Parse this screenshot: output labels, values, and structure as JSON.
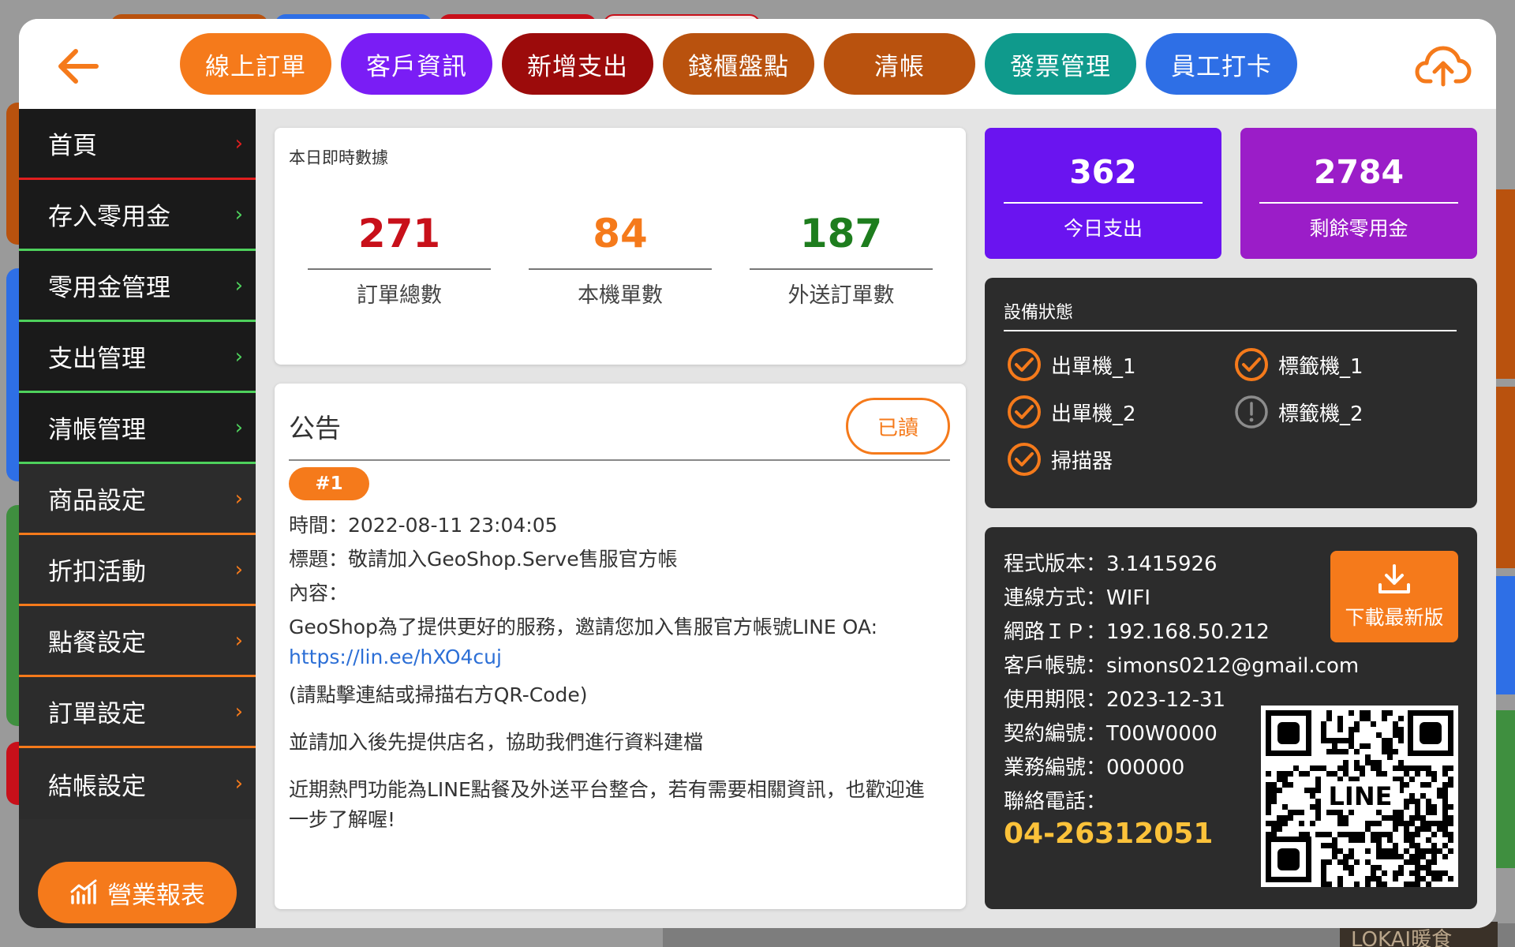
{
  "top_tabs": [
    {
      "label": "線上訂單",
      "color": "#f57a1b"
    },
    {
      "label": "客戶資訊",
      "color": "#7a1df5"
    },
    {
      "label": "新增支出",
      "color": "#9c0b0b"
    },
    {
      "label": "錢櫃盤點",
      "color": "#b9520e"
    },
    {
      "label": "清帳",
      "color": "#b9520e"
    },
    {
      "label": "發票管理",
      "color": "#0f9a8c"
    },
    {
      "label": "員工打卡",
      "color": "#2e6fe6"
    }
  ],
  "sidebar": {
    "items": [
      {
        "label": "首頁"
      },
      {
        "label": "存入零用金"
      },
      {
        "label": "零用金管理"
      },
      {
        "label": "支出管理"
      },
      {
        "label": "清帳管理"
      },
      {
        "label": "商品設定"
      },
      {
        "label": "折扣活動"
      },
      {
        "label": "點餐設定"
      },
      {
        "label": "訂單設定"
      },
      {
        "label": "結帳設定"
      }
    ],
    "chevron": "›",
    "report_button": "營業報表"
  },
  "stats": {
    "title": "本日即時數據",
    "items": [
      {
        "value": "271",
        "label": "訂單總數",
        "color": "#c8101a"
      },
      {
        "value": "84",
        "label": "本機單數",
        "color": "#f57a1b"
      },
      {
        "value": "187",
        "label": "外送訂單數",
        "color": "#1e7d1e"
      }
    ]
  },
  "kpis": [
    {
      "value": "362",
      "label": "今日支出",
      "color": "#6a14f0"
    },
    {
      "value": "2784",
      "label": "剩餘零用金",
      "color": "#9b1dc8"
    }
  ],
  "announcement": {
    "title": "公告",
    "read_button": "已讀",
    "badge": "#1",
    "time": "時間：2022-08-11 23:04:05",
    "subject": "標題：敬請加入GeoShop.Serve售服官方帳",
    "content_label": "內容：",
    "line1": "GeoShop為了提供更好的服務，邀請您加入售服官方帳號LINE OA:",
    "link": "https://lin.ee/hXO4cuj",
    "line2": "(請點擊連結或掃描右方QR-Code)",
    "line3": "並請加入後先提供店名，協助我們進行資料建檔",
    "line4a": "近期熱門功能為LINE點餐及外送平台整合，若有需要相關資訊，也歡迎進",
    "line4b": "一步了解喔!"
  },
  "devices": {
    "title": "設備狀態",
    "items": [
      {
        "name": "出單機_1",
        "status": "ok"
      },
      {
        "name": "標籤機_1",
        "status": "ok"
      },
      {
        "name": "出單機_2",
        "status": "ok"
      },
      {
        "name": "標籤機_2",
        "status": "warning"
      },
      {
        "name": "掃描器",
        "status": "ok"
      }
    ]
  },
  "system_info": {
    "version": "程式版本：3.1415926",
    "connection": "連線方式：WIFI",
    "ip": "網路ＩＰ：192.168.50.212",
    "account": "客戶帳號：simons0212@gmail.com",
    "expiry": "使用期限：2023-12-31",
    "contract": "契約編號：T00W0000",
    "sales_id": "業務編號：000000",
    "phone_label": "聯絡電話：",
    "phone": "04-26312051",
    "download_button": "下載最新版",
    "qr_label": "LINE"
  },
  "background": {
    "corner_text": "LOKAI暖食"
  }
}
